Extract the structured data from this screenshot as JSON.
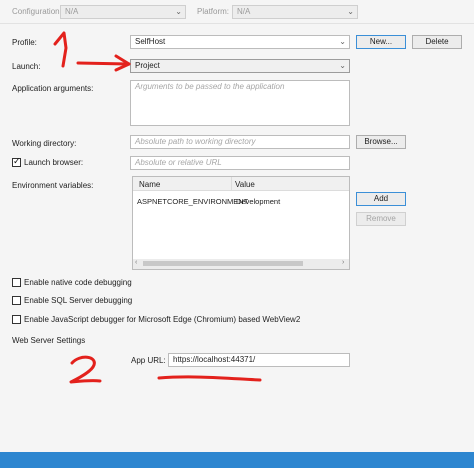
{
  "top": {
    "configuration_label": "Configuration:",
    "configuration_value": "N/A",
    "platform_label": "Platform:",
    "platform_value": "N/A"
  },
  "profile": {
    "label": "Profile:",
    "value": "SelfHost",
    "new_button": "New...",
    "delete_button": "Delete"
  },
  "launch": {
    "label": "Launch:",
    "value": "Project"
  },
  "app_args": {
    "label": "Application arguments:",
    "placeholder": "Arguments to be passed to the application"
  },
  "working_dir": {
    "label": "Working directory:",
    "placeholder": "Absolute path to working directory",
    "browse_button": "Browse..."
  },
  "launch_browser": {
    "label": "Launch browser:",
    "checked": true,
    "placeholder": "Absolute or relative URL"
  },
  "env_vars": {
    "label": "Environment variables:",
    "columns": [
      "Name",
      "Value"
    ],
    "rows": [
      {
        "name": "ASPNETCORE_ENVIRONMENT",
        "value": "Development"
      }
    ],
    "add_button": "Add",
    "remove_button": "Remove"
  },
  "debug_options": [
    {
      "label": "Enable native code debugging",
      "checked": false
    },
    {
      "label": "Enable SQL Server debugging",
      "checked": false
    },
    {
      "label": "Enable JavaScript debugger for Microsoft Edge (Chromium) based WebView2",
      "checked": false
    }
  ],
  "web_server": {
    "section_label": "Web Server Settings",
    "app_url_label": "App URL:",
    "app_url_value": "https://localhost:44371/"
  },
  "annotations": {
    "mark_1": "1",
    "mark_2": "2"
  },
  "colors": {
    "annotation_red": "#e3211c",
    "status_blue": "#2d86d0"
  }
}
